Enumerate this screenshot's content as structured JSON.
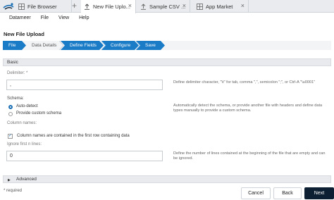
{
  "tabs": [
    {
      "label": "File Browser",
      "icon": "grid-icon",
      "active": false
    },
    {
      "label": "New File Uplo...",
      "icon": "upload-icon",
      "active": true
    },
    {
      "label": "Sample CSV ...",
      "icon": "upload-icon",
      "active": false
    },
    {
      "label": "App Market",
      "icon": "grid-icon",
      "active": false
    }
  ],
  "menu": [
    "Datameer",
    "File",
    "View",
    "Help"
  ],
  "page_title": "New File Upload",
  "wizard": {
    "steps": [
      "File",
      "Data Details",
      "Define Fields",
      "Configure",
      "Save"
    ],
    "active_index": 0,
    "colors": {
      "done": "#1a7bc6",
      "current": "#1a7bc6",
      "todo": "#f3f4f6"
    }
  },
  "basic": {
    "header": "Basic",
    "delimiter": {
      "label": "Delimiter: *",
      "value": ",",
      "help": "Define delimiter character, \"\\t\" for tab, comma \",\", semicolon \";\", or Ctrl-A \"\\u0001\""
    },
    "schema": {
      "label": "Schema:",
      "options": [
        "Auto-detect",
        "Provide custom schema"
      ],
      "selected": "Auto-detect",
      "help": "Automatically detect the schema, or provide another file with headers and define data types manually to provide a custom schema."
    },
    "column_names": {
      "label": "Column names:",
      "checkbox_label": "Column names are contained in the first row containing data",
      "checked": true
    },
    "ignore_lines": {
      "label": "Ignore first n lines:",
      "value": "0",
      "help": "Define the number of lines contained at the beginning of the file that are empty and can be ignored."
    }
  },
  "advanced": {
    "header": "Advanced"
  },
  "footer": {
    "required_note": "* required",
    "cancel": "Cancel",
    "back": "Back",
    "next": "Next"
  }
}
